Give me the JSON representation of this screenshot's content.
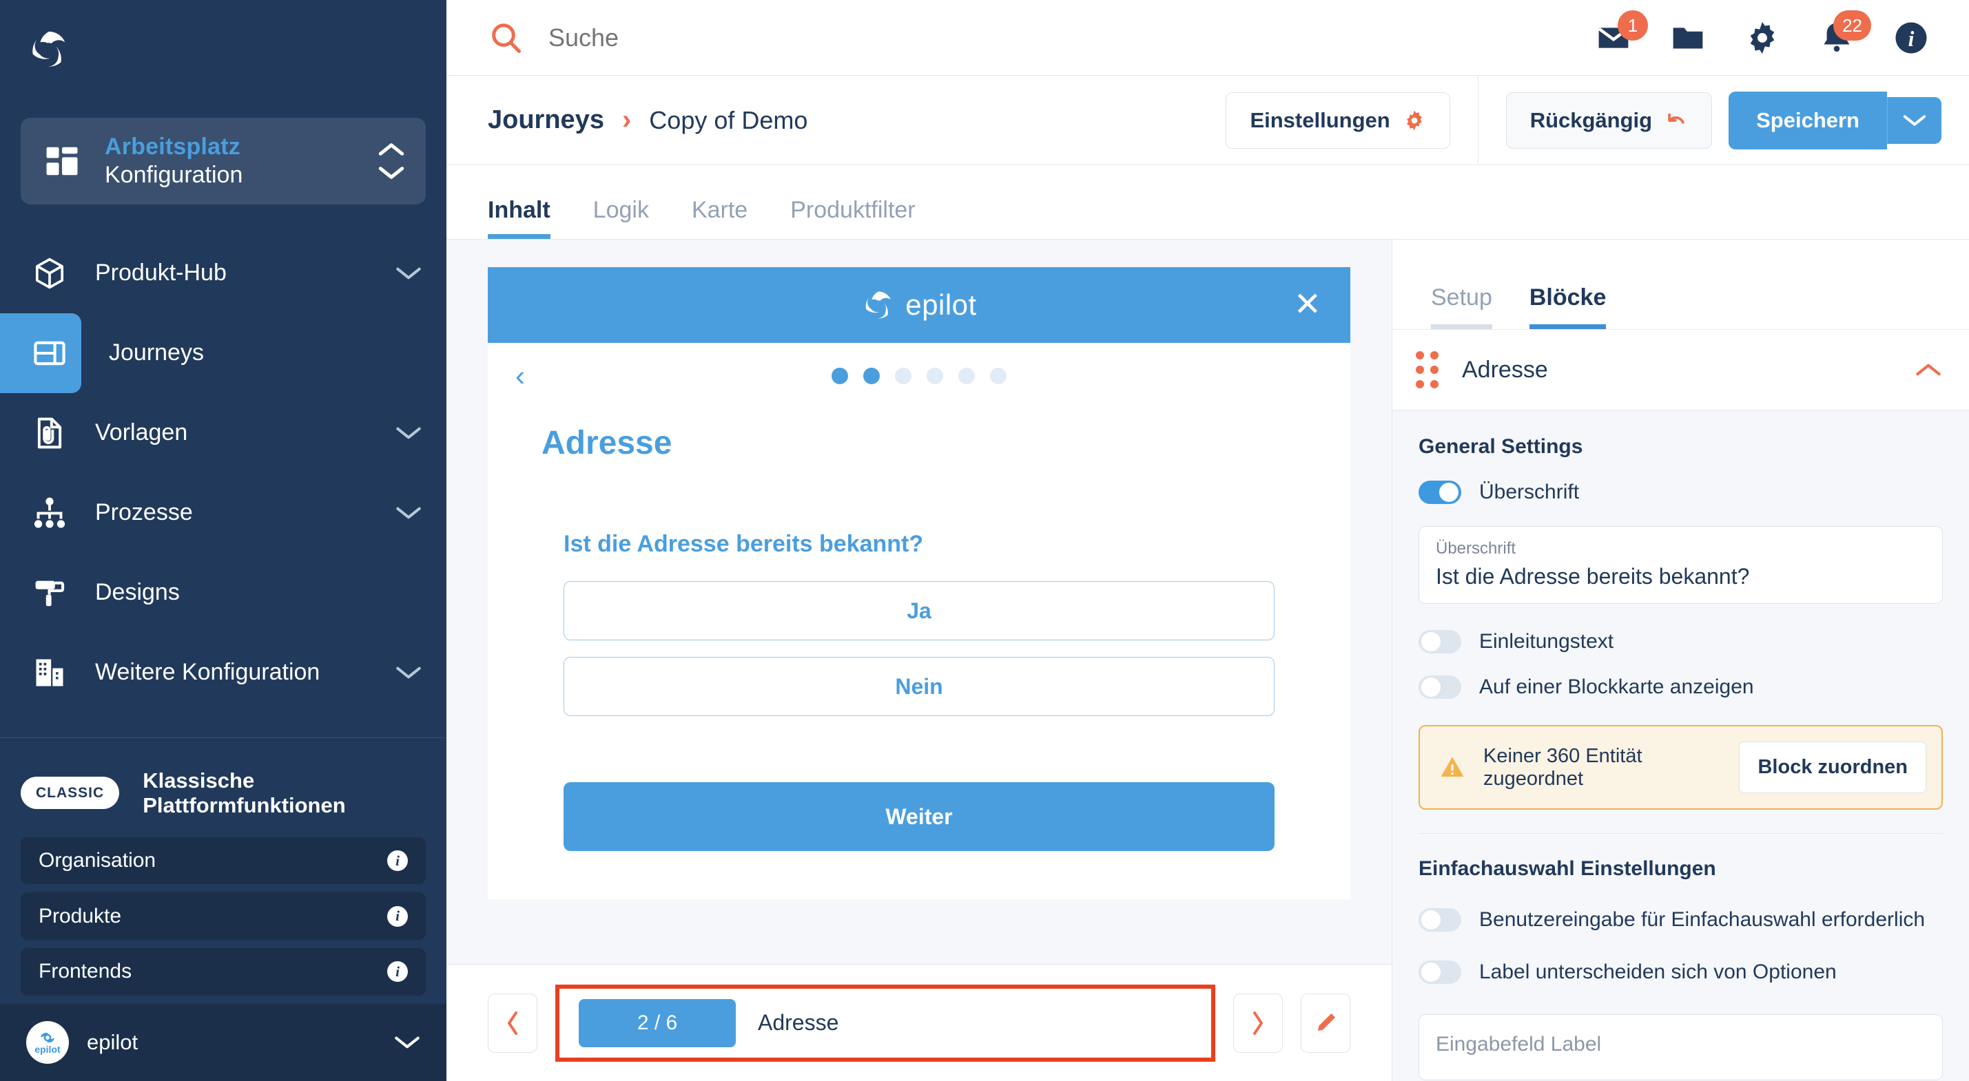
{
  "colors": {
    "sidebar_bg": "#21395a",
    "accent_blue": "#4a9ede",
    "accent_orange": "#ef6d4c",
    "highlight_red": "#e8401f",
    "warn_border": "#edb355",
    "warn_bg": "#fbf3e3"
  },
  "sidebar": {
    "logo_icon": "epilot-swirl-logo-icon",
    "workspace": {
      "icon": "grid-dashboard-icon",
      "title": "Arbeitsplatz",
      "subtitle": "Konfiguration",
      "chevron_up_icon": "chevron-up-icon",
      "chevron_down_icon": "chevron-down-icon"
    },
    "items": [
      {
        "label": "Produkt-Hub",
        "icon": "cube-icon",
        "chevron": "chevron-down-icon",
        "active": false
      },
      {
        "label": "Journeys",
        "icon": "journey-layout-icon",
        "chevron": "",
        "active": true
      },
      {
        "label": "Vorlagen",
        "icon": "document-paperclip-icon",
        "chevron": "chevron-down-icon",
        "active": false
      },
      {
        "label": "Prozesse",
        "icon": "org-chart-icon",
        "chevron": "chevron-down-icon",
        "active": false
      },
      {
        "label": "Designs",
        "icon": "paint-roller-icon",
        "chevron": "",
        "active": false
      },
      {
        "label": "Weitere Konfiguration",
        "icon": "building-icon",
        "chevron": "chevron-down-icon",
        "active": false
      }
    ],
    "classic": {
      "badge": "CLASSIC",
      "label": "Klassische Plattformfunktionen"
    },
    "classic_items": [
      {
        "label": "Organisation",
        "info_icon": "info-icon"
      },
      {
        "label": "Produkte",
        "info_icon": "info-icon"
      },
      {
        "label": "Frontends",
        "info_icon": "info-icon"
      }
    ],
    "footer": {
      "org_name": "epilot",
      "logo_icon": "epilot-circle-logo-icon",
      "chevron": "chevron-down-icon"
    }
  },
  "topbar": {
    "search_icon": "search-icon",
    "search_placeholder": "Suche",
    "search_value": "",
    "icons": [
      {
        "name": "mail-icon",
        "badge": "1"
      },
      {
        "name": "folder-icon",
        "badge": ""
      },
      {
        "name": "gear-icon",
        "badge": ""
      },
      {
        "name": "bell-icon",
        "badge": "22"
      },
      {
        "name": "info-icon",
        "badge": ""
      }
    ]
  },
  "breadcrumb": {
    "root": "Journeys",
    "separator_icon": "chevron-right-icon",
    "current": "Copy of Demo"
  },
  "actions": {
    "settings_label": "Einstellungen",
    "settings_icon": "gear-icon",
    "undo_label": "Rückgängig",
    "undo_icon": "undo-arrow-icon",
    "save_label": "Speichern",
    "save_caret_icon": "chevron-down-icon"
  },
  "tabs": [
    {
      "label": "Inhalt",
      "active": true
    },
    {
      "label": "Logik",
      "active": false
    },
    {
      "label": "Karte",
      "active": false
    },
    {
      "label": "Produktfilter",
      "active": false
    }
  ],
  "preview": {
    "brand": "epilot",
    "brand_icon": "epilot-swirl-logo-icon",
    "close_icon": "close-icon",
    "back_icon": "chevron-left-icon",
    "dots_total": 6,
    "dots_filled": 2,
    "title": "Adresse",
    "question": "Ist die Adresse bereits bekannt?",
    "options": [
      "Ja",
      "Nein"
    ],
    "submit_label": "Weiter"
  },
  "canvas_footer": {
    "prev_icon": "chevron-left-icon",
    "next_icon": "chevron-right-icon",
    "edit_icon": "pencil-icon",
    "step_counter": "2 / 6",
    "step_name": "Adresse"
  },
  "inspector": {
    "tabs": [
      {
        "label": "Setup",
        "active": false
      },
      {
        "label": "Blöcke",
        "active": true
      }
    ],
    "block": {
      "drag_icon": "drag-grip-icon",
      "title": "Adresse",
      "collapse_icon": "chevron-up-icon"
    },
    "general_settings_title": "General Settings",
    "toggles": [
      {
        "label": "Überschrift",
        "on": true
      },
      {
        "label": "Einleitungstext",
        "on": false
      },
      {
        "label": "Auf einer Blockkarte anzeigen",
        "on": false
      }
    ],
    "heading_field": {
      "label": "Überschrift",
      "value": "Ist die Adresse bereits bekannt?"
    },
    "warning": {
      "icon": "warning-triangle-icon",
      "text": "Keiner 360 Entität zugeordnet",
      "button": "Block zuordnen"
    },
    "singleselect_title": "Einfachauswahl Einstellungen",
    "singleselect_toggles": [
      {
        "label": "Benutzereingabe für Einfachauswahl erforderlich",
        "on": false
      },
      {
        "label": "Label unterscheiden sich von Optionen",
        "on": false
      }
    ],
    "input_label_field": {
      "placeholder": "Eingabefeld Label",
      "value": ""
    }
  }
}
